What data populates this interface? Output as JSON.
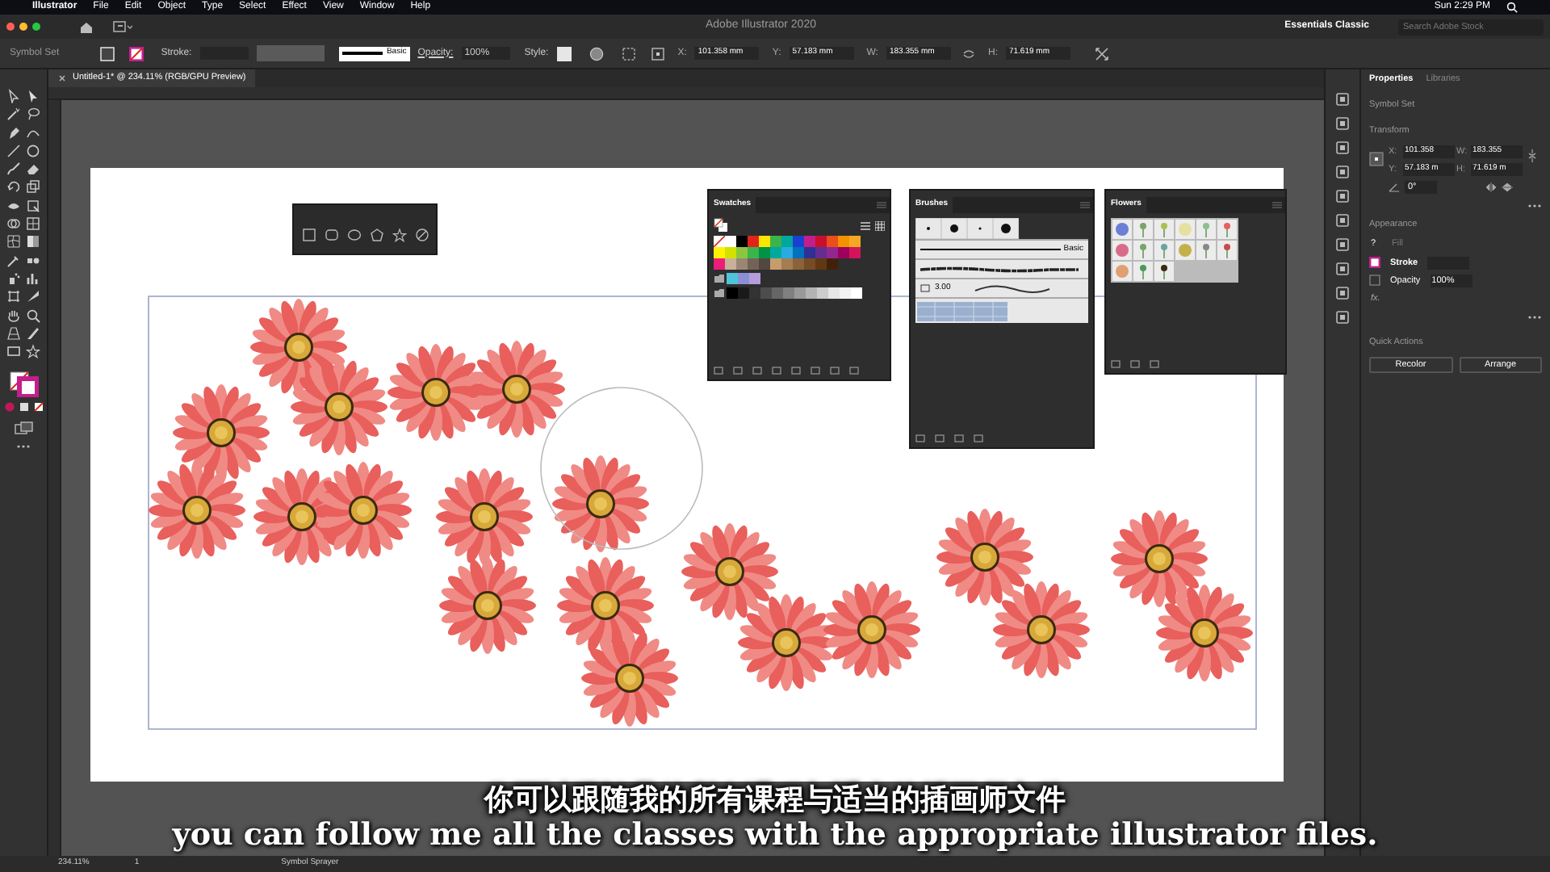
{
  "menu_bar": {
    "app": "Illustrator",
    "items": [
      "File",
      "Edit",
      "Object",
      "Type",
      "Select",
      "Effect",
      "View",
      "Window",
      "Help"
    ],
    "clock": "Sun 2:29 PM"
  },
  "title_bar": {
    "title": "Adobe Illustrator 2020",
    "workspace": "Essentials Classic",
    "search": {
      "placeholder": "Search Adobe Stock"
    }
  },
  "control_bar": {
    "selection": "Symbol Set",
    "stroke_label": "Stroke:",
    "brush": "Basic",
    "opacity_label": "Opacity:",
    "opacity": "100%",
    "style_label": "Style:",
    "fields": [
      {
        "label": "X:",
        "value": "101.358 mm"
      },
      {
        "label": "Y:",
        "value": "57.183 mm"
      },
      {
        "label": "W:",
        "value": "183.355 mm"
      },
      {
        "label": "H:",
        "value": "71.619 mm"
      }
    ]
  },
  "document_tab": {
    "title": "Untitled-1* @ 234.11% (RGB/GPU Preview)"
  },
  "swatches_panel": {
    "title": "Swatches",
    "swatches": [
      {
        "color": "#ffffff"
      },
      {
        "color": "#000000"
      },
      {
        "color": "#e2231a"
      },
      {
        "color": "#ffe600"
      },
      {
        "color": "#3cb44b"
      },
      {
        "color": "#00a79d"
      },
      {
        "color": "#1a3fd1"
      },
      {
        "color": "#c21f8b"
      },
      {
        "color": "#c8102e"
      },
      {
        "color": "#e94e1b"
      },
      {
        "color": "#f39200"
      },
      {
        "color": "#f7a823"
      },
      {
        "color": "#fff200"
      },
      {
        "color": "#d4e000"
      },
      {
        "color": "#8cc63f"
      },
      {
        "color": "#39b54a"
      },
      {
        "color": "#009245"
      },
      {
        "color": "#00a99d"
      },
      {
        "color": "#29abe2"
      },
      {
        "color": "#0071bc"
      },
      {
        "color": "#2e3192"
      },
      {
        "color": "#662d91"
      },
      {
        "color": "#93278f"
      },
      {
        "color": "#9e005d"
      },
      {
        "color": "#d4145a"
      },
      {
        "color": "#ed1e79"
      },
      {
        "color": "#c7b299"
      },
      {
        "color": "#998675"
      },
      {
        "color": "#736357"
      },
      {
        "color": "#534741"
      },
      {
        "color": "#c69c6d"
      },
      {
        "color": "#a67c52"
      },
      {
        "color": "#8c6239"
      },
      {
        "color": "#754c24"
      },
      {
        "color": "#603813"
      },
      {
        "color": "#42210b"
      }
    ],
    "group_colors": [
      {
        "color": "#4fc3d9"
      },
      {
        "color": "#8b8fd6"
      },
      {
        "color": "#b39ddb"
      }
    ],
    "grays": [
      {
        "color": "#000000"
      },
      {
        "color": "#1a1a1a"
      },
      {
        "color": "#333333"
      },
      {
        "color": "#4d4d4d"
      },
      {
        "color": "#666666"
      },
      {
        "color": "#808080"
      },
      {
        "color": "#999999"
      },
      {
        "color": "#b3b3b3"
      },
      {
        "color": "#cccccc"
      },
      {
        "color": "#e6e6e6"
      },
      {
        "color": "#f2f2f2"
      },
      {
        "color": "#ffffff"
      }
    ]
  },
  "brushes_panel": {
    "title": "Brushes",
    "basic": "Basic",
    "size": "3.00"
  },
  "flowers_panel": {
    "title": "Flowers"
  },
  "properties_panel": {
    "tabs": [
      {
        "label": "Properties",
        "selected": true
      },
      {
        "label": "Libraries",
        "selected": false
      }
    ],
    "selection": "Symbol Set",
    "transform": {
      "title": "Transform",
      "fields": [
        {
          "label": "X:",
          "value": "101.358"
        },
        {
          "label": "W:",
          "value": "183.355"
        },
        {
          "label": "Y:",
          "value": "57.183 m"
        },
        {
          "label": "H:",
          "value": "71.619 m"
        }
      ],
      "angle": "0°"
    },
    "appearance": {
      "title": "Appearance",
      "fill_mark": "?",
      "fill": "Fill",
      "stroke": "Stroke",
      "opacity_label": "Opacity",
      "opacity": "100%",
      "fx": "fx."
    },
    "quick_actions": {
      "title": "Quick Actions",
      "buttons": [
        "Recolor",
        "Arrange"
      ]
    }
  },
  "status_bar": {
    "zoom": "234.11%",
    "artboard": "1",
    "tool": "Symbol Sprayer"
  },
  "subtitles": {
    "chinese": "你可以跟随我的所有课程与适当的插画师文件",
    "english": "you can follow me all the classes with the appropriate illustrator files."
  }
}
